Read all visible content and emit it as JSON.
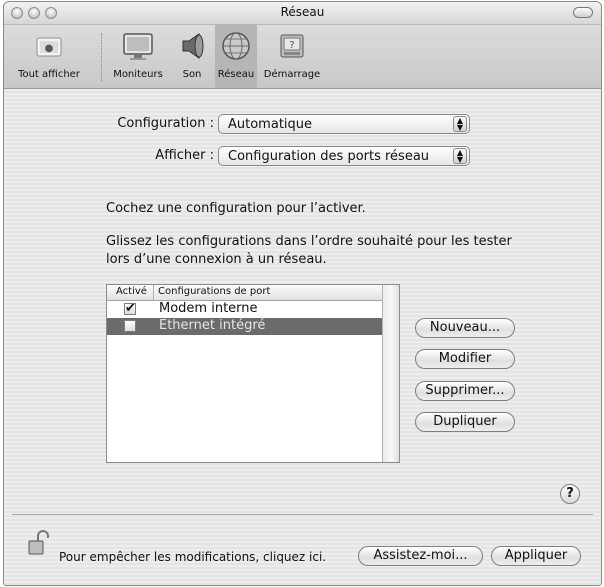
{
  "window": {
    "title": "Réseau"
  },
  "toolbar": {
    "items": [
      {
        "label": "Tout afficher",
        "icon": "show-all-icon"
      },
      {
        "label": "Moniteurs",
        "icon": "monitor-icon"
      },
      {
        "label": "Son",
        "icon": "speaker-icon"
      },
      {
        "label": "Réseau",
        "icon": "network-globe-icon"
      },
      {
        "label": "Démarrage",
        "icon": "startup-disk-icon"
      }
    ],
    "selected": "Réseau"
  },
  "form": {
    "configuration_label": "Configuration :",
    "configuration_value": "Automatique",
    "show_label": "Afficher :",
    "show_value": "Configuration des ports réseau"
  },
  "instructions": {
    "line1": "Cochez une configuration pour l’activer.",
    "line2a": "Glissez les configurations dans l’ordre souhaité pour les tester",
    "line2b": "lors d’une connexion à un réseau."
  },
  "ports_table": {
    "headers": [
      "Activé",
      "Configurations de port"
    ],
    "rows": [
      {
        "active": true,
        "name": "Modem interne",
        "selected": false
      },
      {
        "active": false,
        "name": "Ethernet intégré",
        "selected": true
      }
    ]
  },
  "buttons": {
    "new": "Nouveau...",
    "edit": "Modifier",
    "delete": "Supprimer...",
    "duplicate": "Dupliquer",
    "help": "?",
    "assist": "Assistez-moi...",
    "apply": "Appliquer"
  },
  "lock": {
    "text": "Pour empêcher les modifications, cliquez ici."
  }
}
